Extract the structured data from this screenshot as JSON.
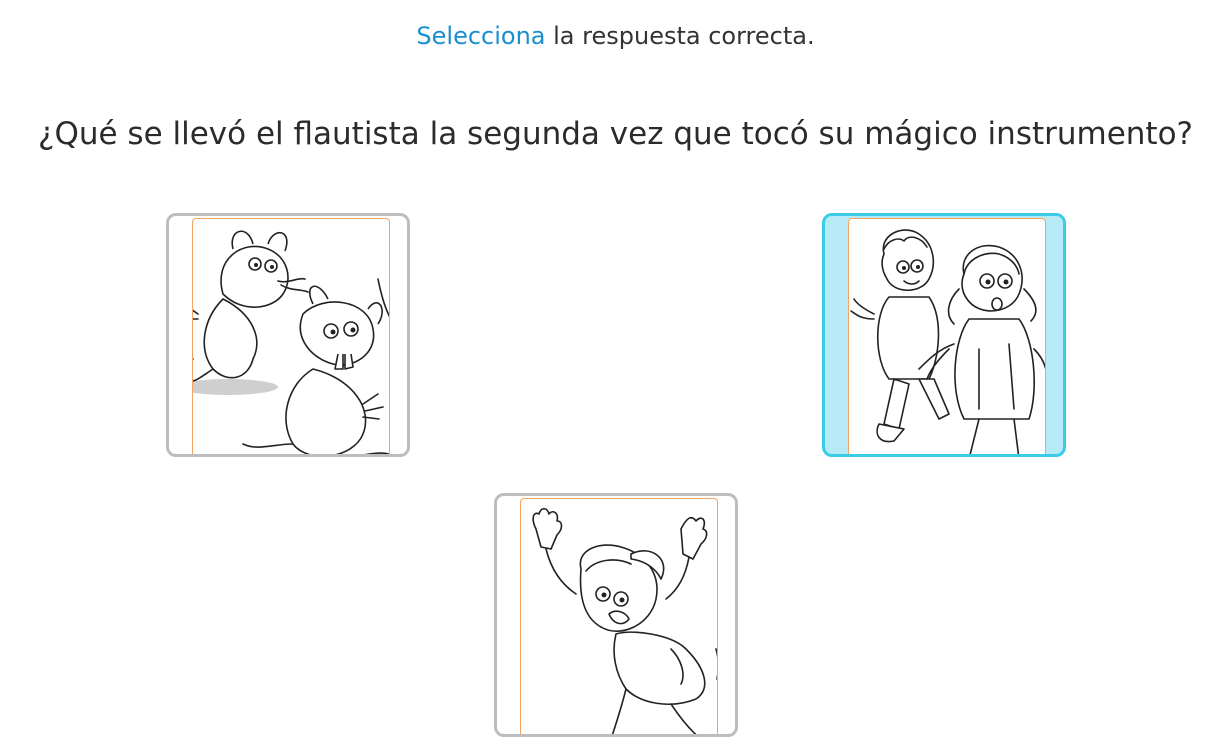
{
  "instruction": {
    "highlight": "Selecciona",
    "rest": " la respuesta correcta."
  },
  "question": {
    "text": "¿Qué se llevó el flautista la segunda vez que tocó su mágico instrumento?"
  },
  "options": [
    {
      "id": "opt1",
      "depicts": "rats",
      "selected": false
    },
    {
      "id": "opt2",
      "depicts": "children",
      "selected": true
    },
    {
      "id": "opt3",
      "depicts": "frightened-woman",
      "selected": false
    }
  ],
  "colors": {
    "highlight": "#1a8fd0",
    "selected_border": "#3ccbe6",
    "selected_fill": "#b6eaf7",
    "card_border": "#bdbdbd",
    "frame_border": "#f2a460"
  }
}
